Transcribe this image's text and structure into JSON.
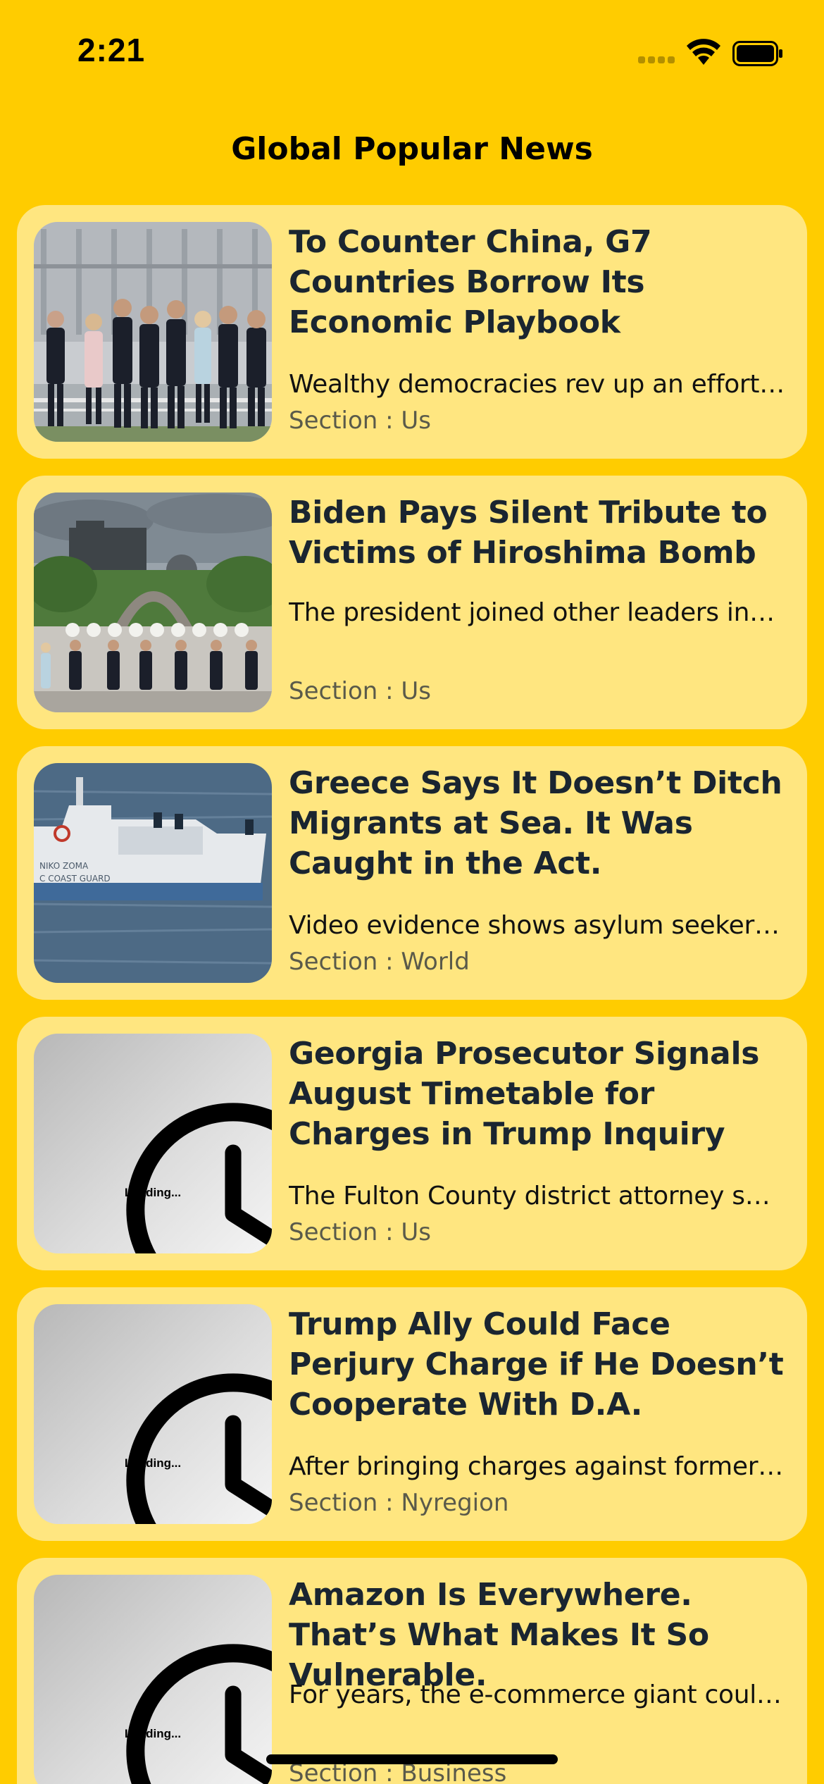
{
  "status_bar": {
    "time": "2:21"
  },
  "header": {
    "title": "Global Popular News"
  },
  "articles": [
    {
      "title": "To Counter China, G7 Countries Borrow Its Economic Playbook",
      "abstract": "Wealthy democracies rev up an effort…",
      "section": "Section : Us",
      "image": "photo-g7-leaders-walking"
    },
    {
      "title": "Biden Pays Silent Tribute to Victims of Hiroshima Bomb",
      "abstract": "The president joined other leaders in…",
      "section": "Section : Us",
      "image": "photo-hiroshima-memorial"
    },
    {
      "title": "Greece Says It Doesn’t Ditch Migrants at Sea. It Was Caught in the Act.",
      "abstract": "Video evidence shows asylum seeker…",
      "section": "Section : World",
      "image": "photo-coast-guard-boat"
    },
    {
      "title": "Georgia Prosecutor Signals August Timetable for Charges in Trump Inquiry",
      "abstract": "The Fulton County district attorney s…",
      "section": "Section : Us",
      "image": "loading-placeholder",
      "loading_label": "Loading..."
    },
    {
      "title": "Trump Ally Could Face Perjury Charge if He Doesn’t Cooperate With D.A.",
      "abstract": "After bringing charges against former…",
      "section": "Section : Nyregion",
      "image": "loading-placeholder",
      "loading_label": "Loading..."
    },
    {
      "title": "Amazon Is Everywhere. That’s What Makes It So Vulnerable.",
      "abstract": "For years, the e-commerce giant coul…",
      "section": "Section : Business",
      "image": "loading-placeholder",
      "loading_label": "Loading..."
    }
  ],
  "colors": {
    "background": "#FFCC00",
    "card": "#FFE680",
    "headline": "#1a2530",
    "section_text": "#5a5a4a"
  }
}
